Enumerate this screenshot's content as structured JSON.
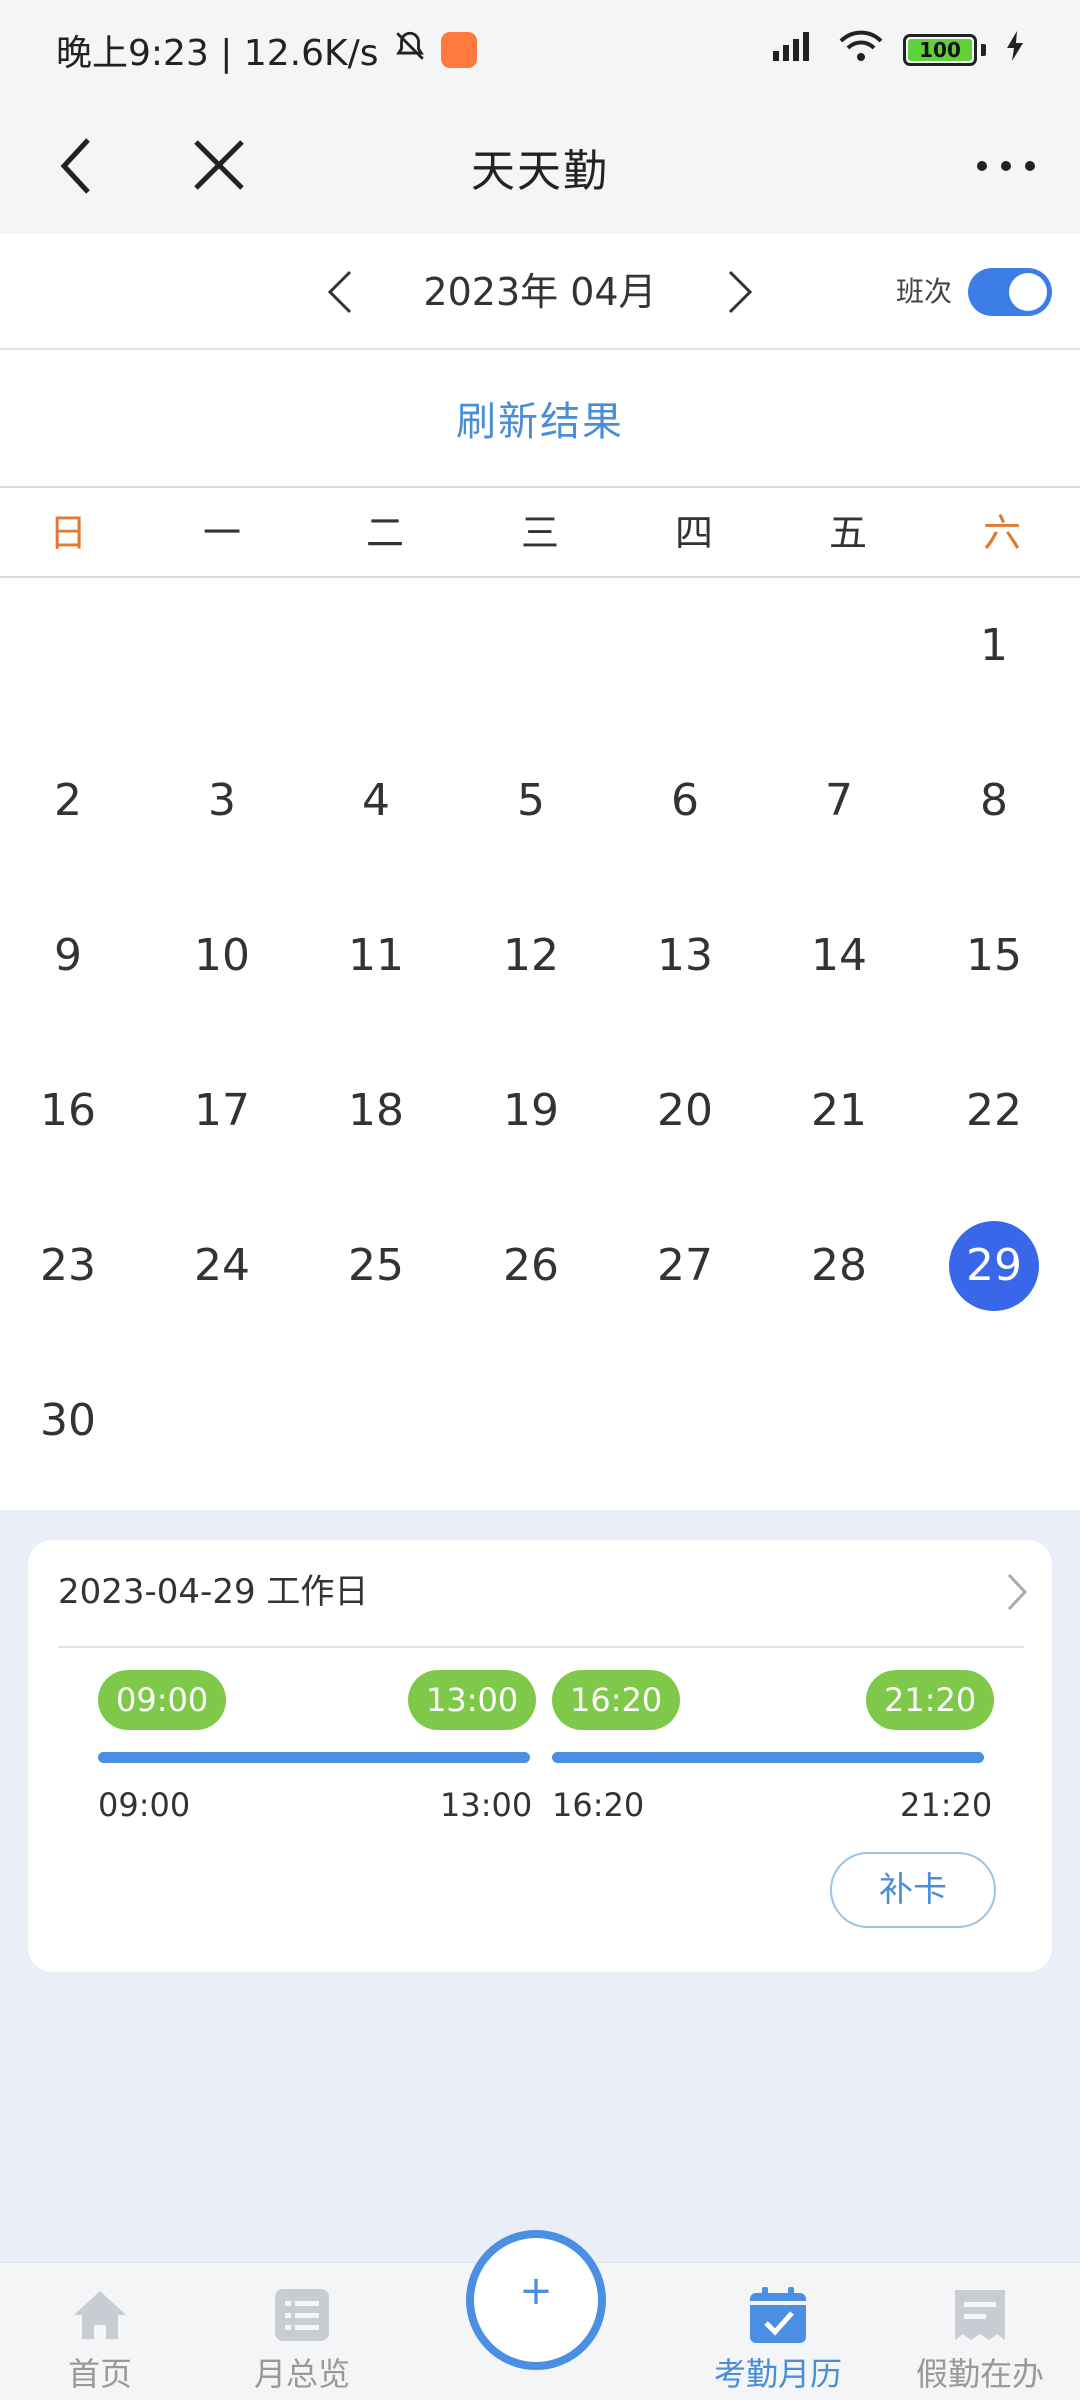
{
  "status_bar": {
    "time_speed": "晚上9:23 | 12.6K/s",
    "battery": "100"
  },
  "header": {
    "title": "天天勤"
  },
  "month_bar": {
    "month": "2023年 04月",
    "shift_label": "班次",
    "shift_toggle_on": true
  },
  "refresh": {
    "label": "刷新结果"
  },
  "weekdays": [
    "日",
    "一",
    "二",
    "三",
    "四",
    "五",
    "六"
  ],
  "calendar": {
    "first_weekday_index": 6,
    "days": [
      "1",
      "2",
      "3",
      "4",
      "5",
      "6",
      "7",
      "8",
      "9",
      "10",
      "11",
      "12",
      "13",
      "14",
      "15",
      "16",
      "17",
      "18",
      "19",
      "20",
      "21",
      "22",
      "23",
      "24",
      "25",
      "26",
      "27",
      "28",
      "29",
      "30"
    ],
    "selected": "29"
  },
  "detail": {
    "title": "2023-04-29 工作日",
    "shift1": {
      "start_pill": "09:00",
      "end_pill": "13:00",
      "start": "09:00",
      "end": "13:00"
    },
    "shift2": {
      "start_pill": "16:20",
      "end_pill": "21:20",
      "start": "16:20",
      "end": "21:20"
    },
    "makeup_label": "补卡"
  },
  "bottom_nav": {
    "home": "首页",
    "monthly_overview": "月总览",
    "fab_plus": "+",
    "attendance_calendar": "考勤月历",
    "leave_pending": "假勤在办"
  },
  "colors": {
    "accent": "#4a8fe3",
    "selected_day": "#3a66ea",
    "weekend": "#e07a33",
    "pill_green": "#7fc94a"
  }
}
